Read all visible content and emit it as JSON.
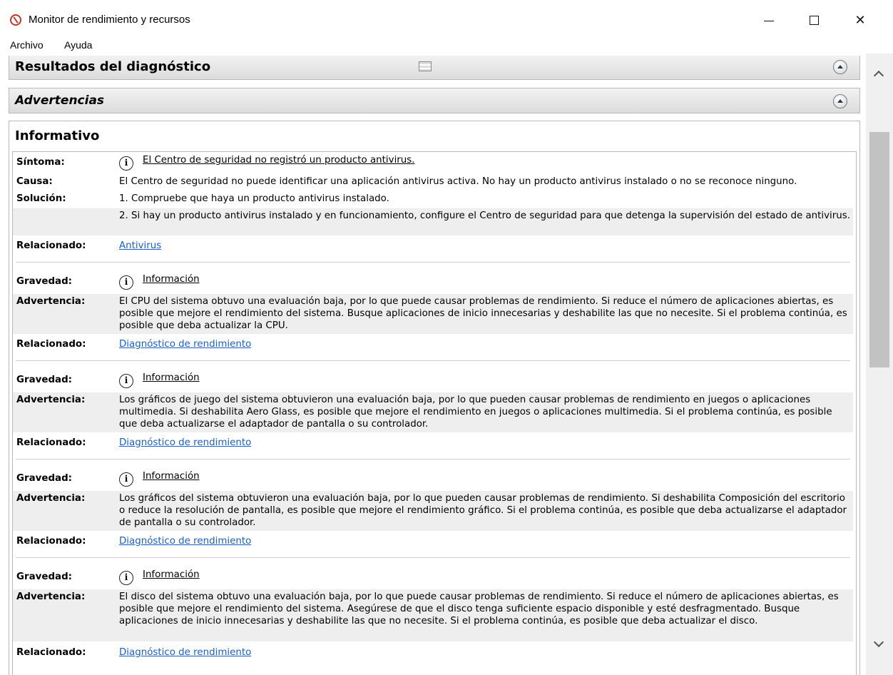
{
  "window": {
    "title": "Monitor de rendimiento y recursos",
    "controls": {
      "minimize": "",
      "maximize": "",
      "close": "✕"
    }
  },
  "menu": {
    "items": [
      "Archivo",
      "Ayuda"
    ]
  },
  "sections": {
    "results": "Resultados del diagnóstico",
    "warnings": "Advertencias",
    "informative": "Informativo"
  },
  "labels": {
    "symptom": "Síntoma:",
    "cause": "Causa:",
    "solution": "Solución:",
    "related": "Relacionado:",
    "severity": "Gravedad:",
    "warning": "Advertencia:"
  },
  "entry1": {
    "symptom": "El Centro de seguridad no registró un producto antivirus.",
    "cause": "El Centro de seguridad no puede identificar una aplicación antivirus activa. No hay un producto antivirus instalado o no se reconoce ninguno.",
    "solution1": "1. Compruebe que haya un producto antivirus instalado.",
    "solution2": "2. Si hay un producto antivirus instalado y en funcionamiento, configure el Centro de seguridad para que detenga la supervisión del estado de antivirus.",
    "related": "Antivirus"
  },
  "severity_value": "Información",
  "entries": [
    {
      "warning": "El CPU del sistema obtuvo una evaluación baja, por lo que puede causar problemas de rendimiento. Si reduce el número de aplicaciones abiertas, es posible que mejore el rendimiento del sistema. Busque aplicaciones de inicio innecesarias y deshabilite las que no necesite. Si el problema continúa, es posible que deba actualizar la CPU.",
      "related": "Diagnóstico de rendimiento"
    },
    {
      "warning": "Los gráficos de juego del sistema obtuvieron una evaluación baja, por lo que pueden causar problemas de rendimiento en juegos o aplicaciones multimedia. Si deshabilita Aero Glass, es posible que mejore el rendimiento en juegos o aplicaciones multimedia. Si el problema continúa, es posible que deba actualizarse el adaptador de pantalla o su controlador.",
      "related": "Diagnóstico de rendimiento"
    },
    {
      "warning": "Los gráficos del sistema obtuvieron una evaluación baja, por lo que pueden causar problemas de rendimiento. Si deshabilita Composición del escritorio o reduce la resolución de pantalla, es posible que mejore el rendimiento gráfico. Si el problema continúa, es posible que deba actualizarse el adaptador de pantalla o su controlador.",
      "related": "Diagnóstico de rendimiento"
    },
    {
      "warning": "El disco del sistema obtuvo una evaluación baja, por lo que puede causar problemas de rendimiento. Si reduce el número de aplicaciones abiertas, es posible que mejore el rendimiento del sistema. Asegúrese de que el disco tenga suficiente espacio disponible y esté desfragmentado. Busque aplicaciones de inicio innecesarias y deshabilite las que no necesite. Si el problema continúa, es posible que deba actualizar el disco.",
      "related": "Diagnóstico de rendimiento"
    }
  ]
}
